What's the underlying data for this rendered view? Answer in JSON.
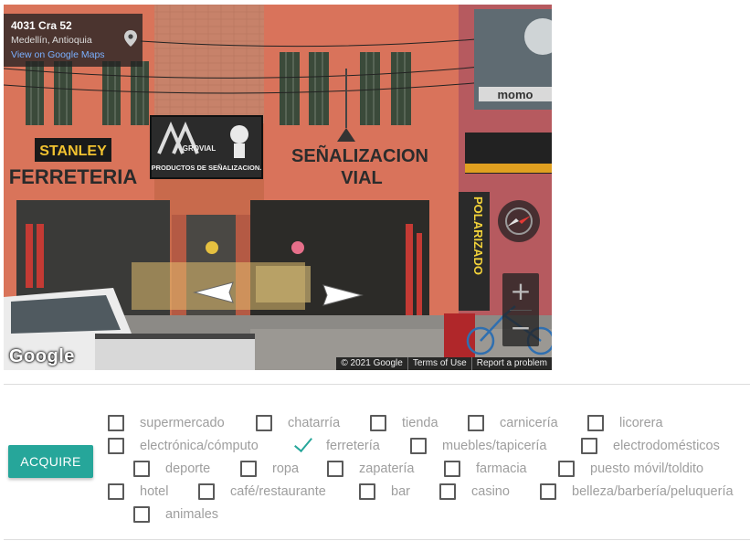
{
  "streetview": {
    "address": "4031 Cra 52",
    "city": "Medellín, Antioquia",
    "maps_link": "View on Google Maps",
    "signs": {
      "stanley": "STANLEY",
      "ferreteria": "FERRETERIA",
      "grovial": "GROVIAL",
      "grovial_sub": "PRODUCTOS DE SEÑALIZACION.",
      "senalizacion": "SEÑALIZACION",
      "vial": "VIAL",
      "polarizado": "POLARIZADO",
      "momo": "momo"
    },
    "zoom_in": "+",
    "zoom_out": "−",
    "logo": "Google",
    "attribution": {
      "copyright": "© 2021 Google",
      "terms": "Terms of Use",
      "report": "Report a problem"
    },
    "icons": [
      "pin-icon",
      "compass-icon",
      "nav-arrow-left-icon",
      "nav-arrow-right-icon"
    ]
  },
  "acquire_button": "ACQUIRE",
  "accent_color": "#26a69a",
  "categories": [
    {
      "label": "supermercado",
      "checked": false
    },
    {
      "label": "chatarría",
      "checked": false
    },
    {
      "label": "tienda",
      "checked": false
    },
    {
      "label": "carnicería",
      "checked": false
    },
    {
      "label": "licorera",
      "checked": false
    },
    {
      "label": "electrónica/cómputo",
      "checked": false
    },
    {
      "label": "ferretería",
      "checked": true
    },
    {
      "label": "muebles/tapicería",
      "checked": false
    },
    {
      "label": "electrodomésticos",
      "checked": false
    },
    {
      "label": "deporte",
      "checked": false
    },
    {
      "label": "ropa",
      "checked": false
    },
    {
      "label": "zapatería",
      "checked": false
    },
    {
      "label": "farmacia",
      "checked": false
    },
    {
      "label": "puesto móvil/toldito",
      "checked": false
    },
    {
      "label": "hotel",
      "checked": false
    },
    {
      "label": "café/restaurante",
      "checked": false
    },
    {
      "label": "bar",
      "checked": false
    },
    {
      "label": "casino",
      "checked": false
    },
    {
      "label": "belleza/barbería/peluquería",
      "checked": false
    },
    {
      "label": "animales",
      "checked": false
    }
  ]
}
